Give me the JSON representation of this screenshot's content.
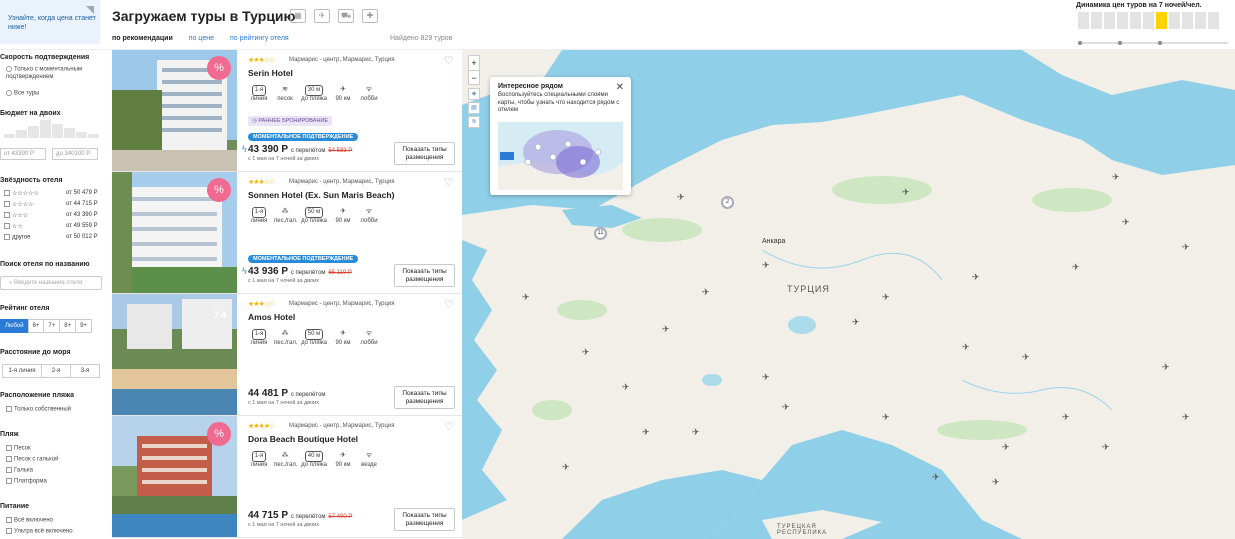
{
  "header": {
    "notify_text": "Узнайте, когда цена станет ниже!",
    "title": "Загружаем туры в Турцию",
    "sort": {
      "by_recommend": "по рекомендации",
      "by_price": "по цене",
      "by_rating": "по рейтингу отеля"
    },
    "found": "Найдено 829 туров",
    "dynamics_label": "Динамика цен туров на 7 ночей/чел."
  },
  "sidebar": {
    "speed_title": "Скорость подтверждения",
    "speed_only": "Только с моментальным подтверждением",
    "speed_all": "Все туры",
    "budget_title": "Бюджет на двоих",
    "budget_from_label": "от",
    "budget_from": "43390 Р",
    "budget_to_label": "до",
    "budget_to": "340100 Р",
    "stars_title": "Звёздность отеля",
    "stars": [
      {
        "label": "☆☆☆☆☆",
        "price": "от 50 479 Р"
      },
      {
        "label": "☆☆☆☆",
        "price": "от 44 715 Р"
      },
      {
        "label": "☆☆☆",
        "price": "от 43 390 Р"
      },
      {
        "label": "☆☆",
        "price": "от 49 559 Р"
      },
      {
        "label": "другое",
        "price": "от 50 012 Р"
      }
    ],
    "search_title": "Поиск отеля по названию",
    "search_placeholder": "Введите название отеля",
    "rating_title": "Рейтинг отеля",
    "rating_options": [
      "Любой",
      "6+",
      "7+",
      "8+",
      "9+"
    ],
    "sea_title": "Расстояние до моря",
    "sea_options": [
      "1-я линия",
      "2-я",
      "3-я"
    ],
    "beach_loc_title": "Расположение пляжа",
    "beach_loc_own": "Только собственный",
    "beach_title": "Пляж",
    "beach_types": [
      "Песок",
      "Песок с галькой",
      "Галька",
      "Платформа"
    ],
    "food_title": "Питание",
    "food_types": [
      "Всё включено",
      "Ультра всё включено"
    ]
  },
  "hotels": [
    {
      "stars": "★★★☆☆",
      "location": "Мармарис - центр, Мармарис, Турция",
      "name": "Serin Hotel",
      "line": "1-я",
      "line_label": "линия",
      "beach_label": "песок",
      "dist": "30 м",
      "dist_label": "до пляжа",
      "airport": "90 км",
      "wifi_label": "лобби",
      "early": "РАННЕЕ БРОНИРОВАНИЕ",
      "instant": "МОМЕНТАЛЬНОЕ ПОДТВЕРЖДЕНИЕ",
      "price": "43 390 Р",
      "with_flight": "с перелётом",
      "old_price": "54 583 Р",
      "subline": "с 1 мая на 7 ночей за двоих",
      "btn": "Показать типы размещения",
      "badge": "%"
    },
    {
      "stars": "★★★☆☆",
      "location": "Мармарис - центр, Мармарис, Турция",
      "name": "Sonnen Hotel (Ex. Sun Maris Beach)",
      "line": "1-я",
      "line_label": "линия",
      "beach_label": "пес./гал.",
      "dist": "50 м",
      "dist_label": "до пляжа",
      "airport": "90 км",
      "wifi_label": "лобби",
      "instant": "МОМЕНТАЛЬНОЕ ПОДТВЕРЖДЕНИЕ",
      "price": "43 936 Р",
      "with_flight": "с перелётом",
      "old_price": "65 119 Р",
      "subline": "с 1 мая на 7 ночей за двоих",
      "btn": "Показать типы размещения",
      "badge": "%"
    },
    {
      "stars": "★★★☆☆",
      "location": "Мармарис - центр, Мармарис, Турция",
      "name": "Amos Hotel",
      "line": "1-я",
      "line_label": "линия",
      "beach_label": "пес./гал.",
      "dist": "50 м",
      "dist_label": "до пляжа",
      "airport": "90 км",
      "wifi_label": "лобби",
      "price": "44 481 Р",
      "with_flight": "с перелётом",
      "subline": "с 1 мая на 7 ночей за двоих",
      "btn": "Показать типы размещения",
      "rating": "7.4"
    },
    {
      "stars": "★★★★☆",
      "location": "Мармарис - центр, Мармарис, Турция",
      "name": "Dora Beach Boutique Hotel",
      "line": "1-я",
      "line_label": "линия",
      "beach_label": "пес./гал.",
      "dist": "40 м",
      "dist_label": "до пляжа",
      "airport": "90 км",
      "wifi_label": "везде",
      "price": "44 715 Р",
      "with_flight": "с перелётом",
      "old_price": "57 400 Р",
      "subline": "с 1 мая на 7 ночей за двоих",
      "btn": "Показать типы размещения",
      "badge": "%"
    }
  ],
  "map": {
    "popup_title": "Интересное рядом",
    "popup_desc": "Воспользуйтесь специальными слоями карты, чтобы узнать что находится рядом с отелем",
    "city_ankara": "Анкара",
    "country_turkey": "ТУРЦИЯ",
    "country_bottom": "ТУРЕЦКАЯ РЕСПУБЛИКА",
    "cluster_1": "2",
    "cluster_2": "11",
    "zoom_in": "+",
    "zoom_out": "−"
  },
  "colors": {
    "accent": "#2a7bd5",
    "sea": "#8fcfe8",
    "land": "#f1efe8",
    "badge": "#f06a92",
    "highlight": "#ffd200"
  }
}
